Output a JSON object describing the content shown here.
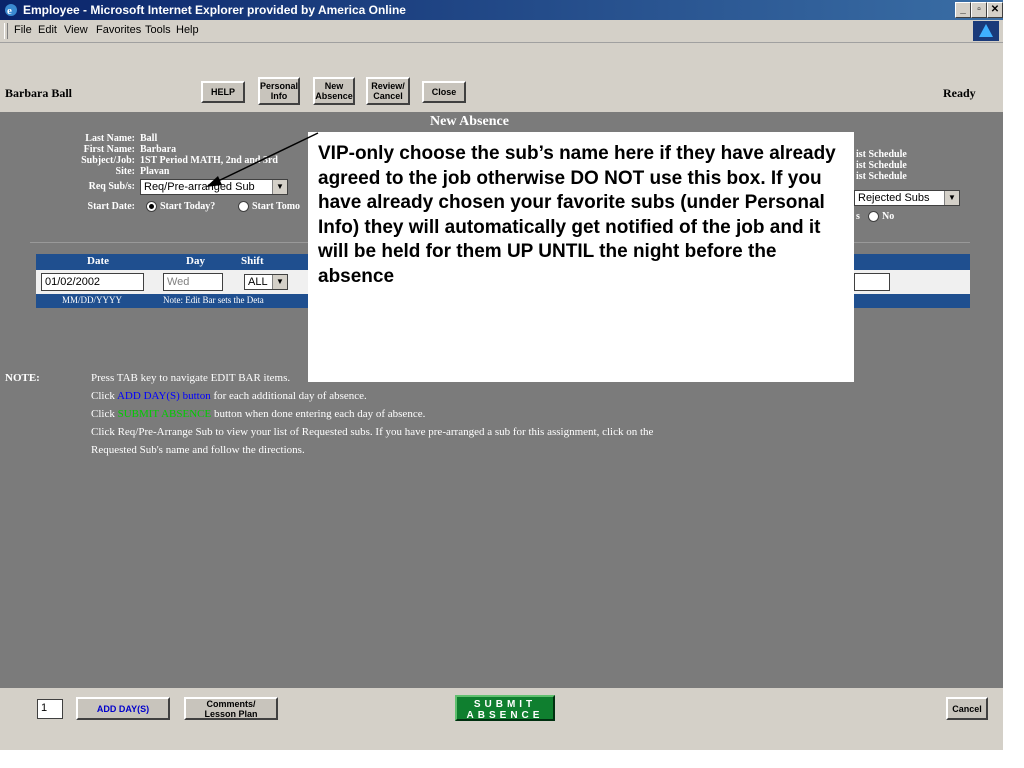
{
  "window": {
    "title": "Employee - Microsoft Internet Explorer provided by America Online"
  },
  "menubar": {
    "items": [
      "File",
      "Edit",
      "View",
      "Favorites",
      "Tools",
      "Help"
    ]
  },
  "toolbar": {
    "user_name": "Barbara Ball",
    "status": "Ready",
    "buttons": {
      "help": "HELP",
      "personal_info": "Personal\nInfo",
      "new_absence": "New\nAbsence",
      "review_cancel": "Review/\nCancel",
      "close": "Close"
    }
  },
  "form": {
    "title": "New Absence",
    "labels": {
      "last_name": "Last Name:",
      "first_name": "First Name:",
      "subject_job": "Subject/Job:",
      "site": "Site:",
      "req_subs": "Req Sub/s:",
      "start_date": "Start Date:"
    },
    "values": {
      "last_name": "Ball",
      "first_name": "Barbara",
      "subject_job": "1ST Period MATH, 2nd and 3rd",
      "site": "Plavan"
    },
    "req_subs_select": "Req/Pre-arranged Sub",
    "start_options": [
      "Start Today?",
      "Start Tomo"
    ],
    "right_column": {
      "line1": "ist Schedule",
      "line2": "ist Schedule",
      "line3": "ist Schedule",
      "rejected_select": "Rejected Subs",
      "yes_fragment": "s",
      "no_option": "No"
    }
  },
  "grid": {
    "headers": [
      "Date",
      "Day",
      "Shift"
    ],
    "row": {
      "date": "01/02/2002",
      "day": "Wed",
      "shift": "ALL"
    },
    "footer": {
      "format": "MM/DD/YYYY",
      "note": "Note: Edit Bar sets the Deta"
    }
  },
  "notes": {
    "label": "NOTE:",
    "line1": "Press TAB key to navigate EDIT BAR items.",
    "line2_pre": "Click ",
    "line2_link": "ADD DAY(S) button",
    "line2_post": " for each additional day of absence.",
    "line3_pre": "Click ",
    "line3_link": "SUBMIT ABSENCE",
    "line3_post": " button when done entering each day of absence.",
    "line4": "Click Req/Pre-Arrange Sub to view your list of Requested subs. If you have pre-arranged a sub for this assignment, click on the",
    "line5": "Requested Sub's name and follow the directions."
  },
  "callout": {
    "text": "VIP-only choose the sub’s name here if they have already agreed to the job otherwise DO NOT use this box.  If you have already chosen your favorite subs (under Personal Info) they will automatically get notified of the job and it will be held for them UP UNTIL the night before the absence"
  },
  "bottom": {
    "days_value": "1",
    "add_day_label": "ADD DAY(S)",
    "comments_label": "Comments/\nLesson Plan",
    "submit_label": "SUBMIT\nABSENCE",
    "cancel_label": "Cancel"
  },
  "colors": {
    "title_bar": "#0a246a",
    "panel": "#7b7b7b",
    "grid_header": "#1f4f8f",
    "submit": "#0f7f2f"
  }
}
